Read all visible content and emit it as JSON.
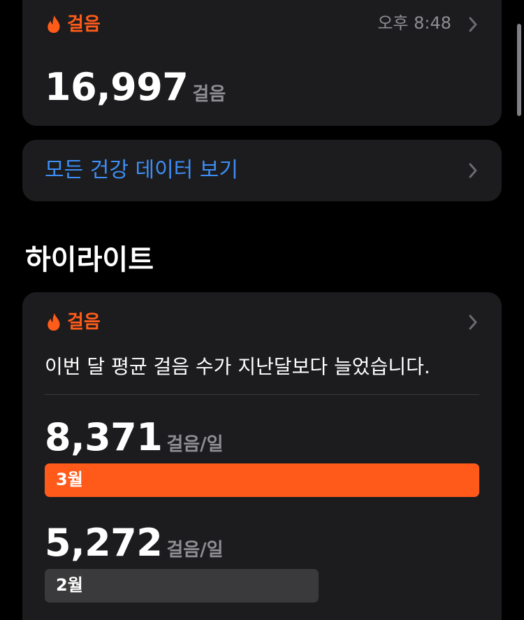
{
  "steps_card": {
    "category": "걸음",
    "time": "오후 8:48",
    "value": "16,997",
    "unit": "걸음"
  },
  "all_data_link": {
    "label": "모든 건강 데이터 보기"
  },
  "highlights": {
    "title": "하이라이트",
    "card": {
      "category": "걸음",
      "summary": "이번 달 평균 걸음 수가 지난달보다 늘었습니다.",
      "months": [
        {
          "value": "8,371",
          "unit": "걸음/일",
          "label": "3월",
          "steps_per_day": 8371,
          "color": "#ff5a1a"
        },
        {
          "value": "5,272",
          "unit": "걸음/일",
          "label": "2월",
          "steps_per_day": 5272,
          "color": "#3a3a3c"
        }
      ]
    }
  },
  "colors": {
    "accent": "#ff5c1a",
    "link": "#3d8ef5",
    "card": "#1c1c1e",
    "secondary_text": "#8e8e93"
  },
  "icons": {
    "category": "flame-icon",
    "disclosure": "chevron-right-icon"
  }
}
